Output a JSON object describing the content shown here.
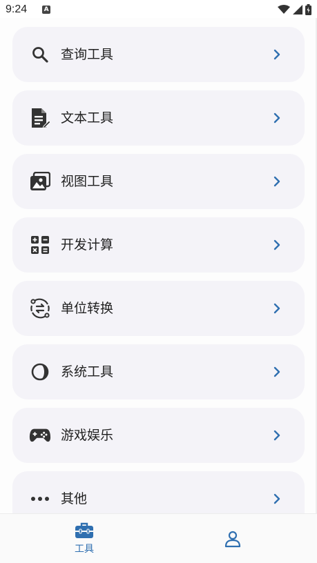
{
  "status_bar": {
    "time": "9:24",
    "notification_icon": "A"
  },
  "menu": {
    "items": [
      {
        "label": "查询工具",
        "icon": "search-icon"
      },
      {
        "label": "文本工具",
        "icon": "text-document-icon"
      },
      {
        "label": "视图工具",
        "icon": "image-gallery-icon"
      },
      {
        "label": "开发计算",
        "icon": "calculator-icon"
      },
      {
        "label": "单位转换",
        "icon": "convert-icon"
      },
      {
        "label": "系统工具",
        "icon": "contrast-icon"
      },
      {
        "label": "游戏娱乐",
        "icon": "gamepad-icon"
      },
      {
        "label": "其他",
        "icon": "more-dots-icon"
      }
    ]
  },
  "bottom_nav": {
    "tools_label": "工具",
    "active_color": "#2f6fb0"
  },
  "colors": {
    "accent": "#2f6fb0",
    "card_bg": "#f4f3f8"
  }
}
